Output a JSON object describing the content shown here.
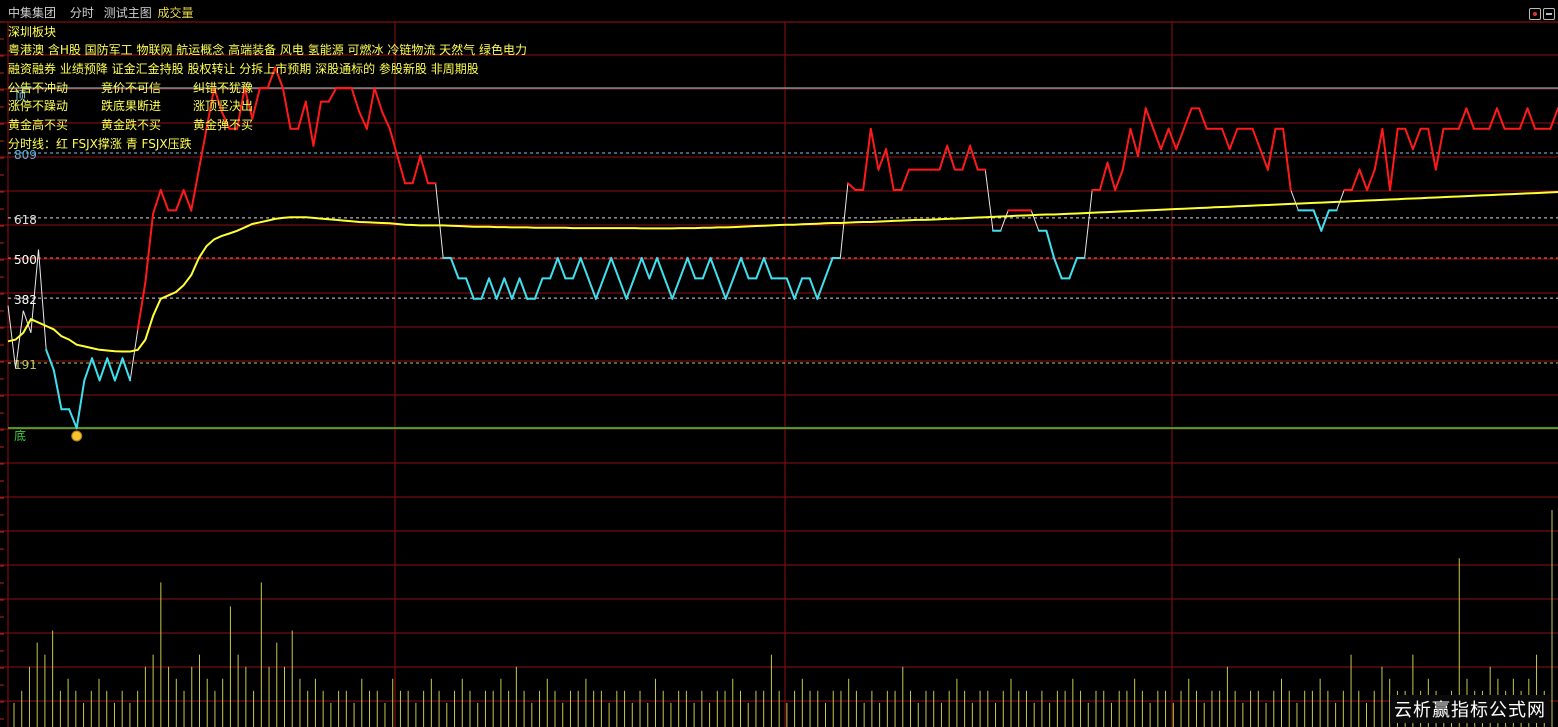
{
  "header": {
    "stock_name": "中集集团",
    "period": "分时",
    "indicator": "测试主图",
    "volume_label": "成交量",
    "btn_settings": "",
    "btn_close": ""
  },
  "info": {
    "sector_title": "深圳板块",
    "concepts_line1": "粤港澳 含H股 国防军工 物联网 航运概念 高端装备 风电 氢能源 可燃冰 冷链物流 天然气 绿色电力",
    "concepts_line2": "融资融券 业绩预降 证金汇金持股 股权转让 分拆上市预期 深股通标的 参股新股 非周期股",
    "rules": [
      [
        "公告不冲动",
        "竞价不可信",
        "纠错不犹豫"
      ],
      [
        "涨停不躁动",
        "跌底果断进",
        "涨顶坚决出"
      ],
      [
        "黄金高不买",
        "黄金跌不买",
        "黄金弹不买"
      ]
    ],
    "legend": "分时线：红 FSJX撑涨 青 FSJX压跌"
  },
  "chart_data": {
    "type": "line",
    "title": "",
    "fib_levels": [
      {
        "label": "809",
        "value": 809
      },
      {
        "label": "618",
        "value": 618
      },
      {
        "label": "500",
        "value": 500
      },
      {
        "label": "382",
        "value": 382
      },
      {
        "label": "191",
        "value": 191
      }
    ],
    "markers": {
      "top": "顶",
      "bottom": "底"
    },
    "price": [
      360,
      175,
      345,
      280,
      525,
      230,
      170,
      55,
      55,
      0,
      140,
      205,
      140,
      205,
      140,
      205,
      140,
      290,
      430,
      630,
      700,
      640,
      640,
      700,
      640,
      760,
      880,
      1000,
      930,
      880,
      880,
      1000,
      910,
      1000,
      1000,
      1060,
      1000,
      880,
      880,
      960,
      830,
      960,
      960,
      1000,
      1000,
      1000,
      930,
      880,
      1000,
      930,
      880,
      800,
      720,
      720,
      800,
      720,
      720,
      500,
      500,
      440,
      440,
      380,
      380,
      440,
      380,
      440,
      380,
      440,
      380,
      380,
      440,
      440,
      500,
      440,
      440,
      500,
      440,
      380,
      440,
      500,
      440,
      380,
      440,
      500,
      440,
      500,
      440,
      380,
      440,
      500,
      440,
      440,
      500,
      440,
      380,
      440,
      500,
      440,
      440,
      500,
      440,
      440,
      440,
      380,
      440,
      440,
      380,
      440,
      500,
      500,
      720,
      700,
      700,
      880,
      760,
      820,
      700,
      700,
      760,
      760,
      760,
      760,
      760,
      830,
      760,
      760,
      830,
      760,
      760,
      580,
      580,
      640,
      640,
      640,
      640,
      580,
      580,
      500,
      440,
      440,
      500,
      500,
      700,
      700,
      780,
      700,
      760,
      880,
      800,
      940,
      880,
      820,
      880,
      820,
      880,
      940,
      940,
      880,
      880,
      880,
      820,
      880,
      880,
      880,
      820,
      760,
      880,
      880,
      700,
      640,
      640,
      640,
      580,
      640,
      640,
      700,
      700,
      760,
      700,
      760,
      880,
      700,
      880,
      880,
      820,
      880,
      880,
      760,
      880,
      880,
      880,
      940,
      880,
      880,
      880,
      940,
      880,
      880,
      880,
      940,
      880,
      880,
      880,
      940
    ],
    "avg": [
      255,
      260,
      280,
      320,
      310,
      300,
      290,
      270,
      260,
      245,
      240,
      235,
      230,
      228,
      226,
      225,
      225,
      230,
      260,
      330,
      380,
      390,
      400,
      420,
      450,
      500,
      535,
      555,
      565,
      572,
      580,
      590,
      600,
      605,
      610,
      615,
      618,
      620,
      620,
      620,
      618,
      616,
      614,
      612,
      610,
      608,
      606,
      605,
      604,
      603,
      602,
      600,
      598,
      597,
      596,
      596,
      596,
      596,
      595,
      594,
      593,
      592,
      592,
      592,
      591,
      591,
      590,
      590,
      590,
      589,
      589,
      589,
      589,
      589,
      588,
      588,
      588,
      588,
      588,
      588,
      588,
      588,
      588,
      587,
      587,
      587,
      587,
      587,
      588,
      588,
      588,
      589,
      589,
      590,
      590,
      591,
      592,
      593,
      594,
      595,
      596,
      597,
      598,
      598,
      599,
      600,
      601,
      602,
      603,
      603,
      604,
      605,
      606,
      606,
      607,
      608,
      609,
      610,
      611,
      612,
      612,
      613,
      614,
      615,
      616,
      617,
      618,
      619,
      620,
      621,
      622,
      623,
      624,
      625,
      626,
      627,
      628,
      628,
      629,
      630,
      631,
      632,
      633,
      634,
      635,
      636,
      637,
      638,
      639,
      640,
      641,
      642,
      643,
      644,
      645,
      646,
      647,
      648,
      649,
      650,
      651,
      652,
      653,
      654,
      655,
      656,
      657,
      658,
      659,
      660,
      661,
      662,
      663,
      664,
      665,
      666,
      667,
      668,
      669,
      670,
      671,
      672,
      673,
      674,
      675,
      676,
      677,
      678,
      679,
      680,
      681,
      682,
      683,
      684,
      685,
      686,
      687,
      688,
      689,
      690,
      691,
      692,
      693,
      694,
      695
    ],
    "volume": [
      2,
      3,
      5,
      7,
      6,
      8,
      3,
      4,
      3,
      2,
      3,
      4,
      3,
      2,
      3,
      2,
      3,
      5,
      6,
      12,
      5,
      4,
      3,
      5,
      6,
      4,
      3,
      4,
      10,
      6,
      5,
      3,
      12,
      5,
      7,
      5,
      8,
      4,
      3,
      4,
      3,
      2,
      3,
      3,
      2,
      4,
      3,
      3,
      2,
      4,
      3,
      3,
      2,
      3,
      4,
      3,
      2,
      3,
      4,
      3,
      2,
      3,
      3,
      4,
      3,
      5,
      3,
      2,
      3,
      4,
      3,
      2,
      3,
      3,
      4,
      3,
      3,
      2,
      3,
      3,
      2,
      3,
      2,
      4,
      3,
      2,
      3,
      3,
      2,
      3,
      2,
      3,
      3,
      4,
      3,
      2,
      3,
      3,
      6,
      3,
      2,
      3,
      4,
      3,
      3,
      2,
      3,
      3,
      4,
      3,
      2,
      3,
      2,
      3,
      3,
      5,
      3,
      2,
      3,
      3,
      2,
      3,
      4,
      3,
      2,
      3,
      3,
      2,
      3,
      4,
      3,
      3,
      2,
      3,
      2,
      3,
      3,
      4,
      3,
      2,
      3,
      3,
      2,
      3,
      3,
      4,
      3,
      2,
      3,
      3,
      2,
      3,
      4,
      3,
      2,
      3,
      3,
      5,
      3,
      2,
      3,
      3,
      2,
      3,
      4,
      3,
      2,
      3,
      3,
      4,
      3,
      2,
      3,
      6,
      3,
      2,
      3,
      5,
      4,
      3,
      3,
      6,
      3,
      4,
      3,
      2,
      3,
      14,
      4,
      3,
      3,
      5,
      4,
      3,
      4,
      3,
      4,
      6,
      3,
      18
    ],
    "watermark": "云析赢指标公式网"
  }
}
